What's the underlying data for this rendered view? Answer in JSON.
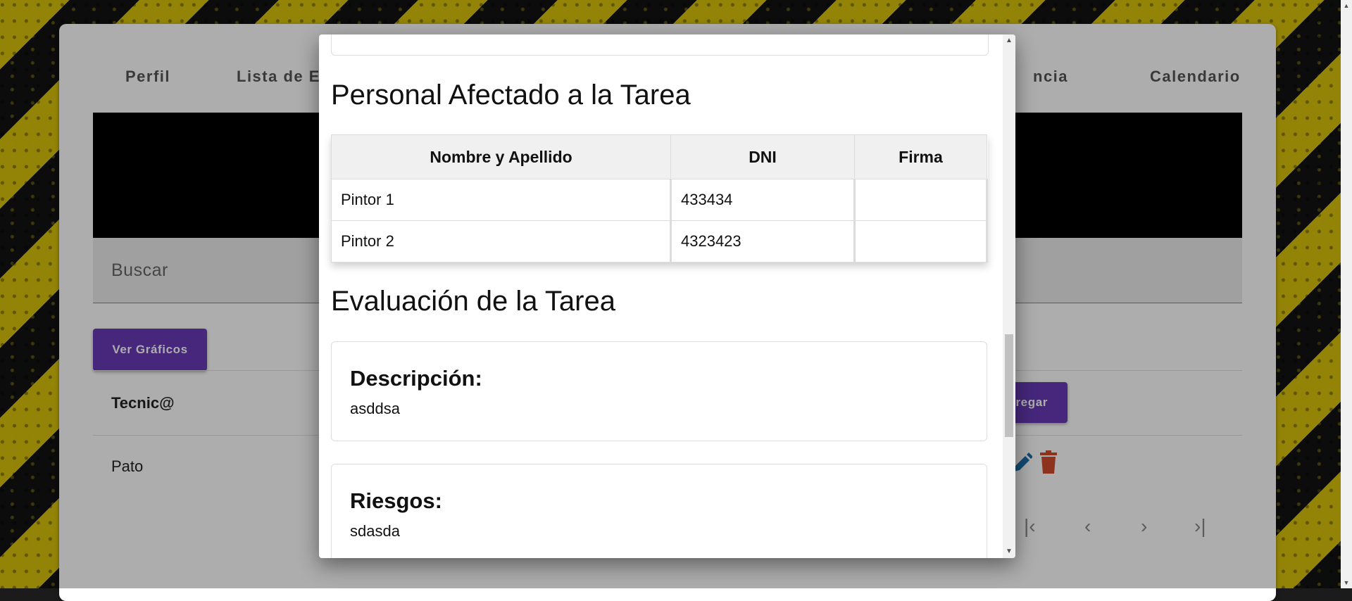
{
  "background_app": {
    "tabs": [
      "Perfil",
      "Lista de E",
      "ncia",
      "Calendario"
    ],
    "search_placeholder": "Buscar",
    "charts_button": "Ver Gráficos",
    "add_button": "regar",
    "table_header": "Tecnic@",
    "table_row": "Pato",
    "pager_icons": [
      "first-page-icon",
      "prev-page-icon",
      "next-page-icon",
      "last-page-icon"
    ]
  },
  "modal": {
    "personal_title": "Personal Afectado a la Tarea",
    "columns": [
      "Nombre y Apellido",
      "DNI",
      "Firma"
    ],
    "rows": [
      {
        "name": "Pintor 1",
        "dni": "433434",
        "firma": ""
      },
      {
        "name": "Pintor 2",
        "dni": "4323423",
        "firma": ""
      }
    ],
    "evaluacion_title": "Evaluación de la Tarea",
    "descripcion_label": "Descripción:",
    "descripcion_value": "asddsa",
    "riesgos_label": "Riesgos:",
    "riesgos_value": "sdasda"
  },
  "colors": {
    "accent": "#673ab7",
    "edit_icon": "#1e6fa8",
    "delete_icon": "#d04a2c",
    "hazard_yellow": "#d9c20a"
  }
}
